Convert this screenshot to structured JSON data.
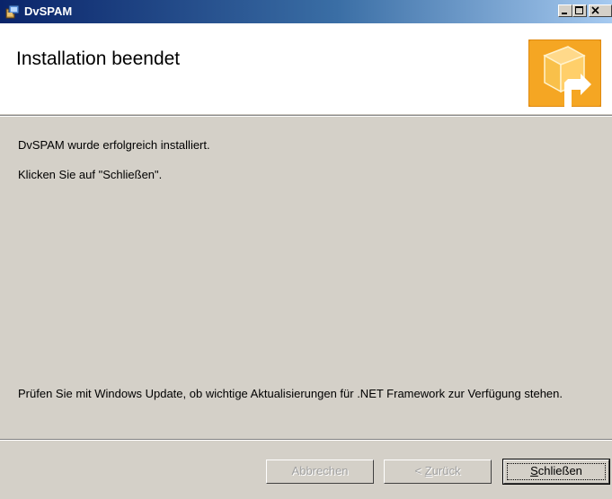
{
  "window": {
    "title": "DvSPAM",
    "app_icon": "installer-icon",
    "controls": [
      "minimize-icon",
      "maximize-icon",
      "close-icon"
    ]
  },
  "header": {
    "title": "Installation beendet",
    "graphic": "box-arrow-icon"
  },
  "content": {
    "line1": "DvSPAM wurde erfolgreich installiert.",
    "line2": "Klicken Sie auf \"Schließen\".",
    "note": "Prüfen Sie mit Windows Update, ob wichtige Aktualisierungen für .NET Framework zur Verfügung stehen."
  },
  "buttons": {
    "cancel": "Abbrechen",
    "back_prefix": "< ",
    "back_accel": "Z",
    "back_rest": "urück",
    "close_accel": "S",
    "close_rest": "chließen"
  },
  "colors": {
    "titlebar_start": "#0a246a",
    "titlebar_end": "#a6caf0",
    "dialog_bg": "#d4d0c8",
    "accent": "#f5a623"
  }
}
